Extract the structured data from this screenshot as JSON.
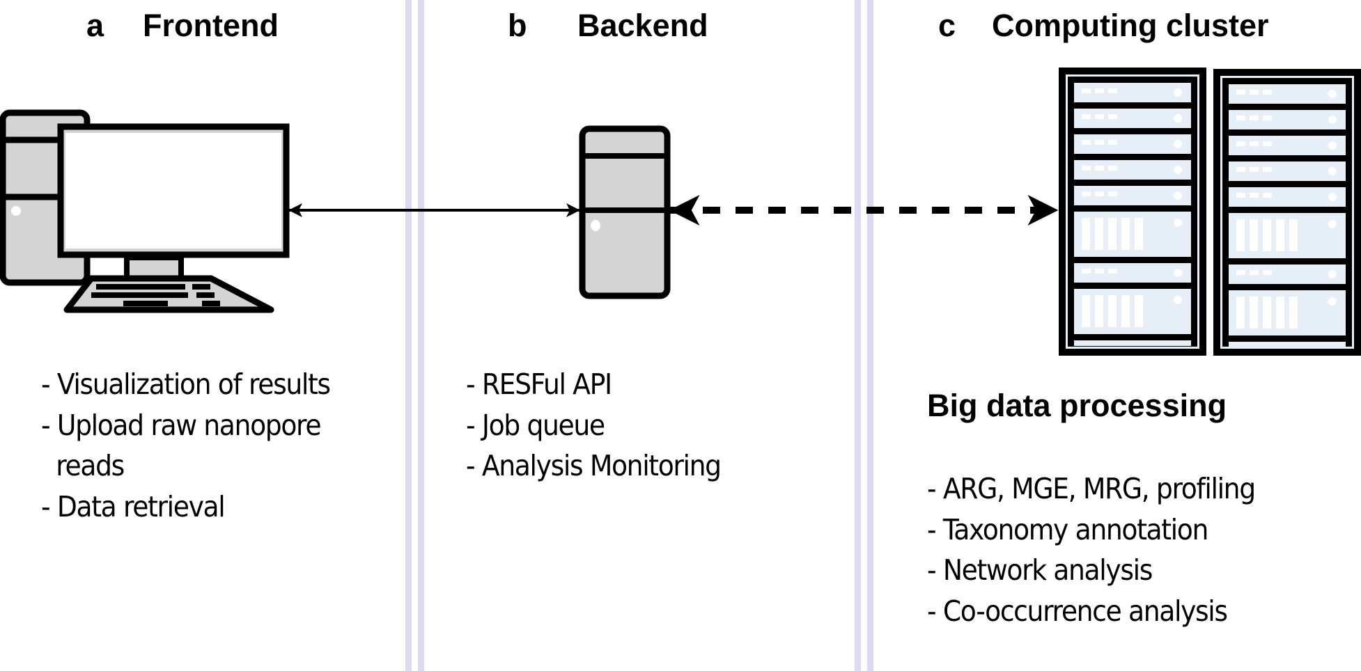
{
  "panels": {
    "frontend": {
      "letter": "a",
      "title": "Frontend",
      "items": [
        "- Visualization of results",
        "- Upload raw nanopore",
        "  reads",
        "- Data retrieval"
      ]
    },
    "backend": {
      "letter": "b",
      "title": "Backend",
      "items": [
        "- RESFul API",
        "- Job queue",
        "- Analysis Monitoring"
      ]
    },
    "cluster": {
      "letter": "c",
      "title": "Computing cluster",
      "subtitle": "Big data processing",
      "items": [
        "- ARG, MGE, MRG, profiling",
        "- Taxonomy annotation",
        "- Network analysis",
        "- Co-occurrence analysis"
      ]
    }
  },
  "icons": {
    "frontend": "desktop-computer-icon",
    "backend": "server-tower-icon",
    "cluster": "server-rack-icon"
  },
  "connections": [
    {
      "from": "frontend",
      "to": "backend",
      "style": "solid",
      "direction": "bidirectional"
    },
    {
      "from": "backend",
      "to": "cluster",
      "style": "dashed",
      "direction": "bidirectional"
    }
  ],
  "colors": {
    "divider": "#dcdaf0",
    "device_fill": "#d4d4d4",
    "rack_fill": "#e6eef8",
    "stroke": "#000000"
  }
}
